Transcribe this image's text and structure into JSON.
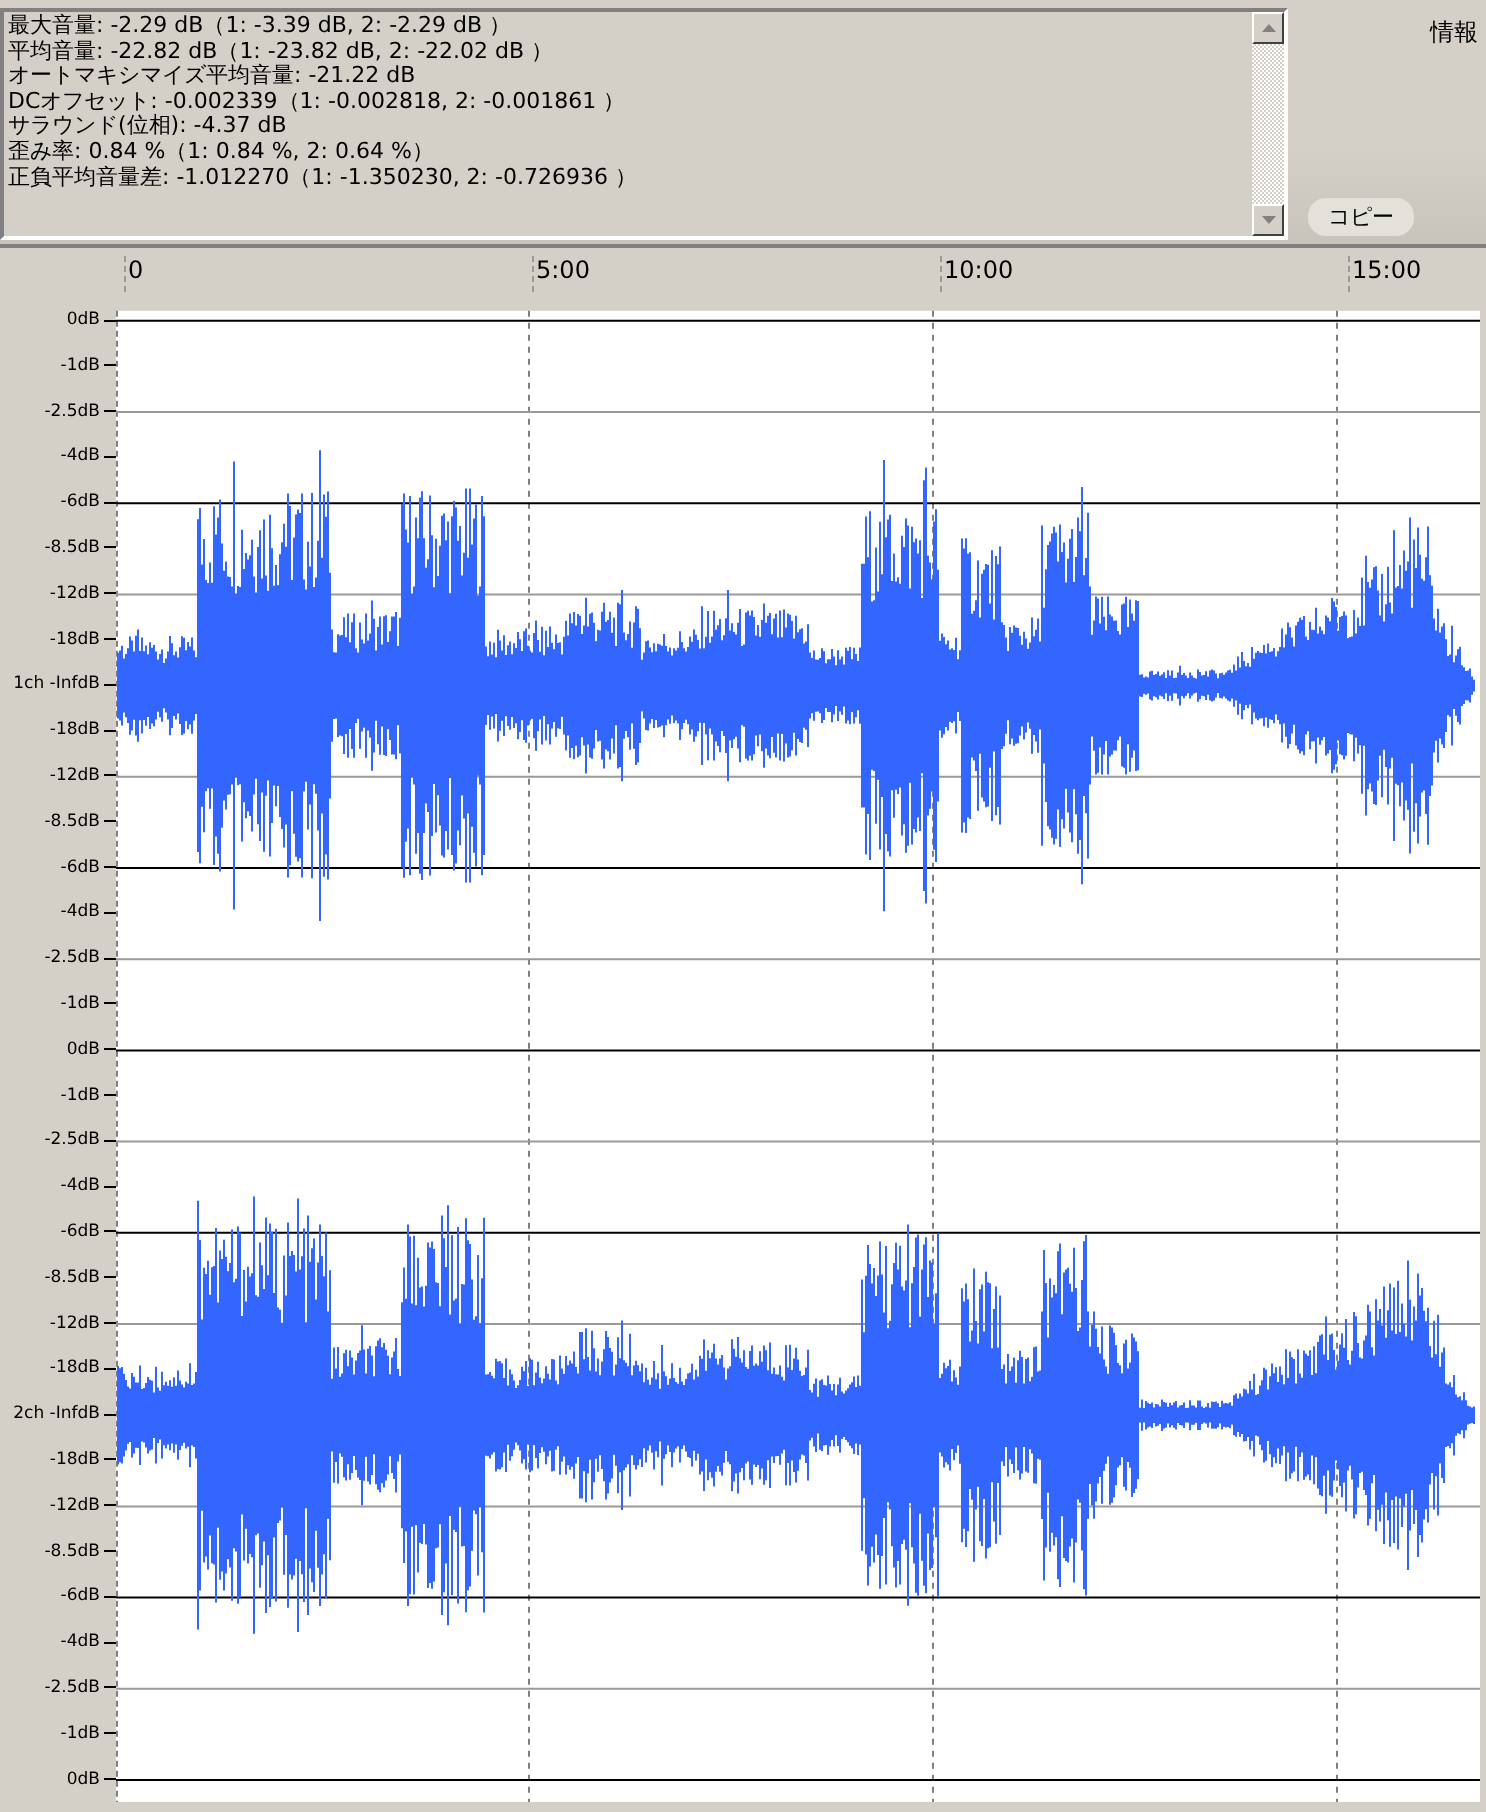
{
  "info": {
    "lines": [
      "最大音量: -2.29 dB（1: -3.39 dB, 2: -2.29 dB ）",
      "平均音量: -22.82 dB（1: -23.82 dB, 2: -22.02 dB ）",
      "オートマキシマイズ平均音量: -21.22 dB",
      "DCオフセット: -0.002339（1: -0.002818, 2: -0.001861 ）",
      "サラウンド(位相): -4.37 dB",
      "歪み率: 0.84 %（1: 0.84 %, 2: 0.64 %）",
      "正負平均音量差: -1.012270（1: -1.350230, 2: -0.726936 ）"
    ]
  },
  "panel": {
    "title": "情報",
    "copy_button": "コピー"
  },
  "timeline": [
    "0",
    "5:00",
    "10:00",
    "15:00"
  ],
  "axis_ticks": [
    {
      "label": "0dB",
      "kind": "major"
    },
    {
      "label": "-1dB",
      "kind": "plain"
    },
    {
      "label": "-2.5dB",
      "kind": "minor"
    },
    {
      "label": "-4dB",
      "kind": "plain"
    },
    {
      "label": "-6dB",
      "kind": "major"
    },
    {
      "label": "-8.5dB",
      "kind": "plain"
    },
    {
      "label": "-12dB",
      "kind": "minor"
    },
    {
      "label": "-18dB",
      "kind": "plain"
    },
    {
      "label": "1ch -InfdB",
      "kind": "plain"
    },
    {
      "label": "-18dB",
      "kind": "plain"
    },
    {
      "label": "-12dB",
      "kind": "minor"
    },
    {
      "label": "-8.5dB",
      "kind": "plain"
    },
    {
      "label": "-6dB",
      "kind": "major"
    },
    {
      "label": "-4dB",
      "kind": "plain"
    },
    {
      "label": "-2.5dB",
      "kind": "minor"
    },
    {
      "label": "-1dB",
      "kind": "plain"
    },
    {
      "label": "0dB",
      "kind": "major"
    },
    {
      "label": "-1dB",
      "kind": "plain"
    },
    {
      "label": "-2.5dB",
      "kind": "minor"
    },
    {
      "label": "-4dB",
      "kind": "plain"
    },
    {
      "label": "-6dB",
      "kind": "major"
    },
    {
      "label": "-8.5dB",
      "kind": "plain"
    },
    {
      "label": "-12dB",
      "kind": "minor"
    },
    {
      "label": "-18dB",
      "kind": "plain"
    },
    {
      "label": "2ch -InfdB",
      "kind": "plain"
    },
    {
      "label": "-18dB",
      "kind": "plain"
    },
    {
      "label": "-12dB",
      "kind": "minor"
    },
    {
      "label": "-8.5dB",
      "kind": "plain"
    },
    {
      "label": "-6dB",
      "kind": "major"
    },
    {
      "label": "-4dB",
      "kind": "plain"
    },
    {
      "label": "-2.5dB",
      "kind": "minor"
    },
    {
      "label": "-1dB",
      "kind": "plain"
    },
    {
      "label": "0dB",
      "kind": "major"
    }
  ]
}
